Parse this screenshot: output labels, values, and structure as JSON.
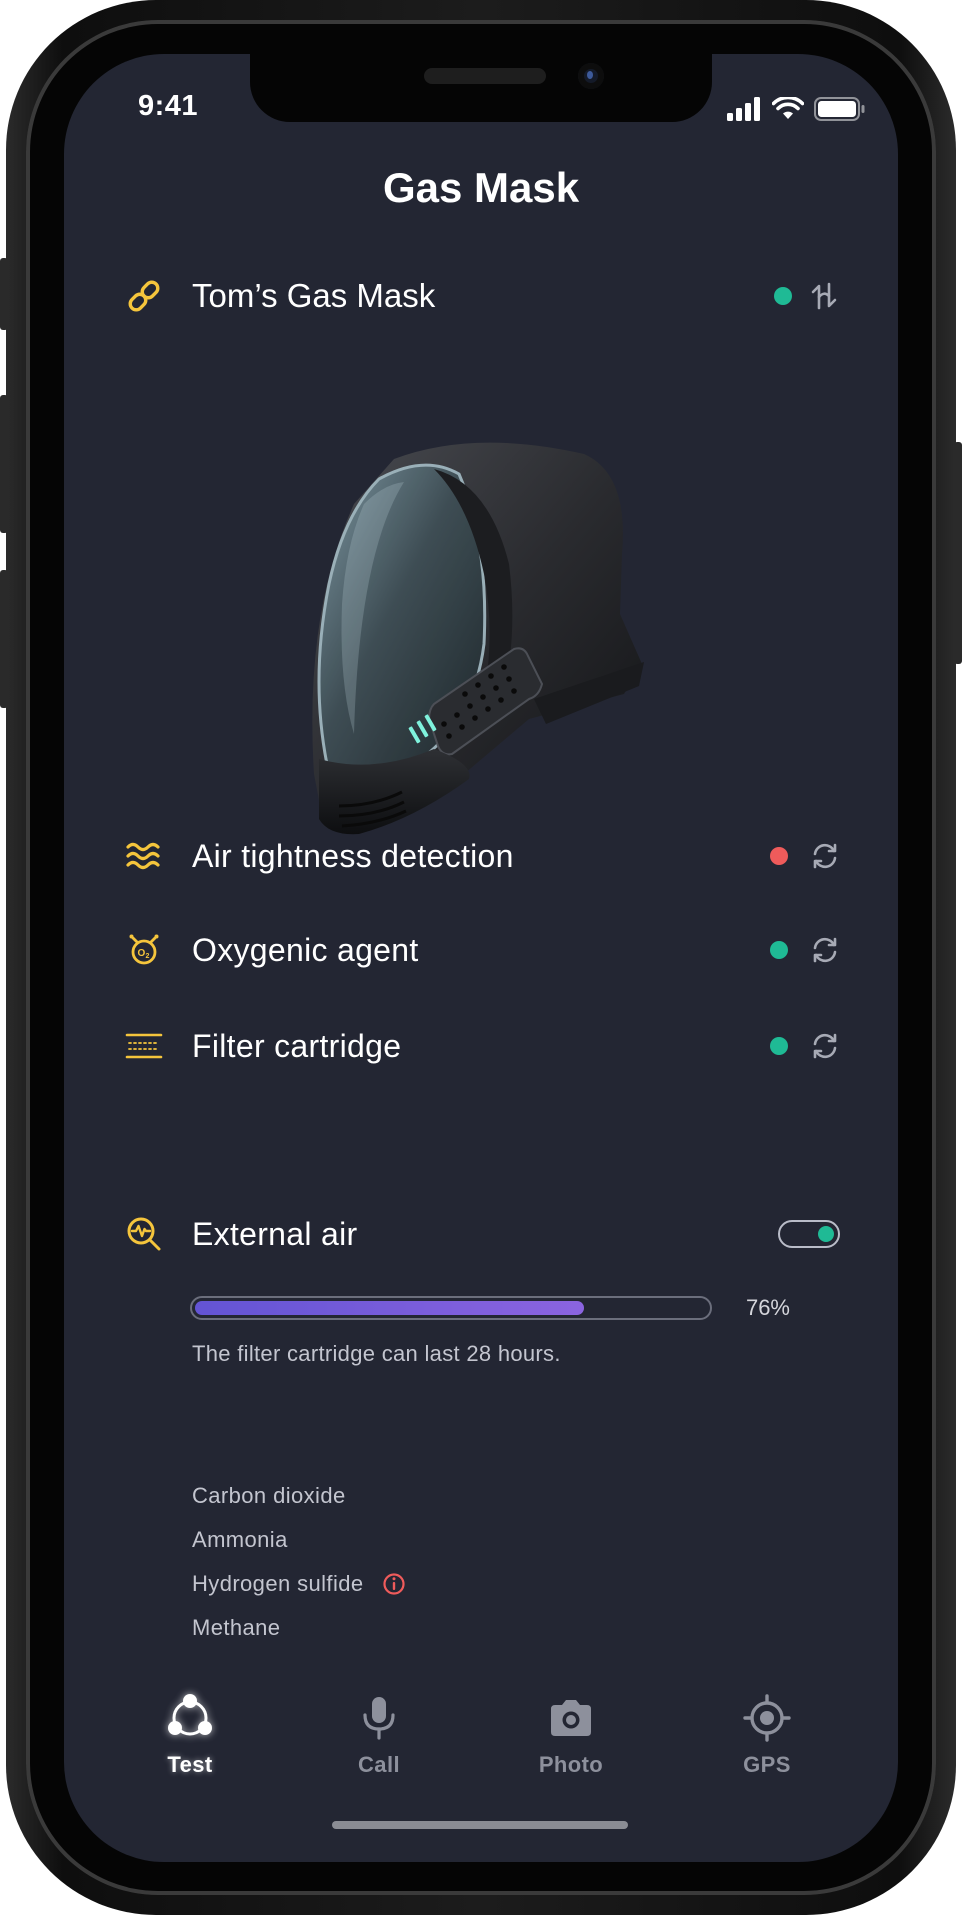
{
  "status_bar": {
    "time": "9:41"
  },
  "app": {
    "title": "Gas Mask"
  },
  "device": {
    "name": "Tom’s Gas Mask",
    "connected": true
  },
  "colors": {
    "background": "#232633",
    "accent_yellow": "#f5c53c",
    "status_ok": "#1fba95",
    "status_error": "#ef5b5b",
    "progress_start": "#6354d4",
    "progress_end": "#8b64e0"
  },
  "features": [
    {
      "label": "Air tightness detection",
      "icon": "waves-icon",
      "status": "error"
    },
    {
      "label": "Oxygenic agent",
      "icon": "oxygen-icon",
      "status": "ok"
    },
    {
      "label": "Filter cartridge",
      "icon": "filter-icon",
      "status": "ok"
    }
  ],
  "filter": {
    "progress": 0.76,
    "percent_label": "76%",
    "note": "The filter cartridge can last 28 hours."
  },
  "external_air": {
    "label": "External air",
    "enabled": true,
    "gases": [
      {
        "name": "Carbon dioxide",
        "warning": false
      },
      {
        "name": "Ammonia",
        "warning": false
      },
      {
        "name": "Hydrogen sulfide",
        "warning": true
      },
      {
        "name": "Methane",
        "warning": false
      }
    ]
  },
  "tabs": [
    {
      "label": "Test",
      "icon": "test-icon",
      "active": true
    },
    {
      "label": "Call",
      "icon": "microphone-icon",
      "active": false
    },
    {
      "label": "Photo",
      "icon": "camera-icon",
      "active": false
    },
    {
      "label": "GPS",
      "icon": "gps-icon",
      "active": false
    }
  ]
}
